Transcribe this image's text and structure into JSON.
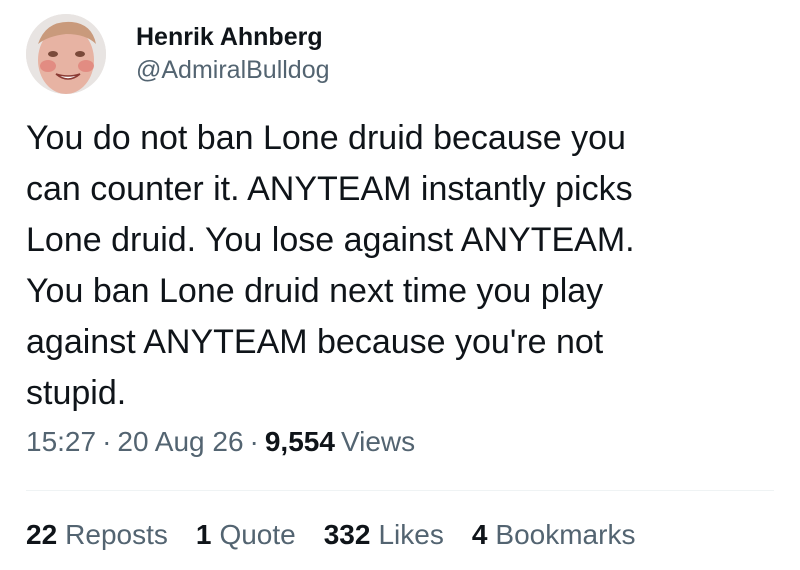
{
  "author": {
    "name": "Henrik Ahnberg",
    "handle": "@AdmiralBulldog"
  },
  "tweet": {
    "text": "You do not ban Lone druid because you\ncan counter it. ANYTEAM instantly picks\nLone druid. You lose against ANYTEAM.\nYou ban Lone druid next time you play\nagainst ANYTEAM because you're not\nstupid."
  },
  "meta": {
    "time": "15:27",
    "date": "20 Aug 26",
    "separator": "·",
    "views_count": "9,554",
    "views_label": "Views"
  },
  "stats": [
    {
      "count": "22",
      "label": "Reposts"
    },
    {
      "count": "1",
      "label": "Quote"
    },
    {
      "count": "332",
      "label": "Likes"
    },
    {
      "count": "4",
      "label": "Bookmarks"
    }
  ],
  "colors": {
    "primary_text": "#0f1419",
    "secondary_text": "#536471",
    "divider": "#eff3f4"
  }
}
